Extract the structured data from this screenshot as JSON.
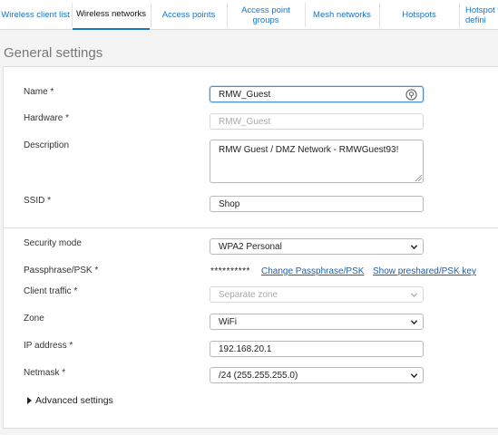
{
  "tabs": [
    {
      "label": "Wireless client list",
      "active": false
    },
    {
      "label": "Wireless networks",
      "active": true
    },
    {
      "label": "Access points",
      "active": false
    },
    {
      "label": "Access point\ngroups",
      "active": false
    },
    {
      "label": "Mesh networks",
      "active": false
    },
    {
      "label": "Hotspots",
      "active": false
    },
    {
      "label": "Hotspot v\ndefini",
      "active": false
    }
  ],
  "section_title": "General settings",
  "form": {
    "name": {
      "label": "Name *",
      "value": "RMW_Guest"
    },
    "hardware": {
      "label": "Hardware *",
      "placeholder": "RMW_Guest"
    },
    "description": {
      "label": "Description",
      "value": "RMW Guest / DMZ Network - RMWGuest93!"
    },
    "ssid": {
      "label": "SSID *",
      "value": "Shop"
    },
    "security_mode": {
      "label": "Security mode",
      "value": "WPA2 Personal"
    },
    "passphrase": {
      "label": "Passphrase/PSK *",
      "masked": "**********",
      "change_link": "Change Passphrase/PSK",
      "show_link": "Show preshared/PSK key"
    },
    "client_traffic": {
      "label": "Client traffic *",
      "value": "Separate zone"
    },
    "zone": {
      "label": "Zone",
      "value": "WiFi"
    },
    "ip_address": {
      "label": "IP address *",
      "value": "192.168.20.1"
    },
    "netmask": {
      "label": "Netmask *",
      "value": "/24 (255.255.255.0)"
    }
  },
  "advanced_settings": "Advanced settings",
  "colors": {
    "accent": "#1a73c8",
    "link": "#1a5fa8",
    "focus": "#4a8fc9"
  },
  "icons": {
    "key": "key-icon",
    "chevron": "chevron-down-icon",
    "caret": "caret-right-icon"
  }
}
